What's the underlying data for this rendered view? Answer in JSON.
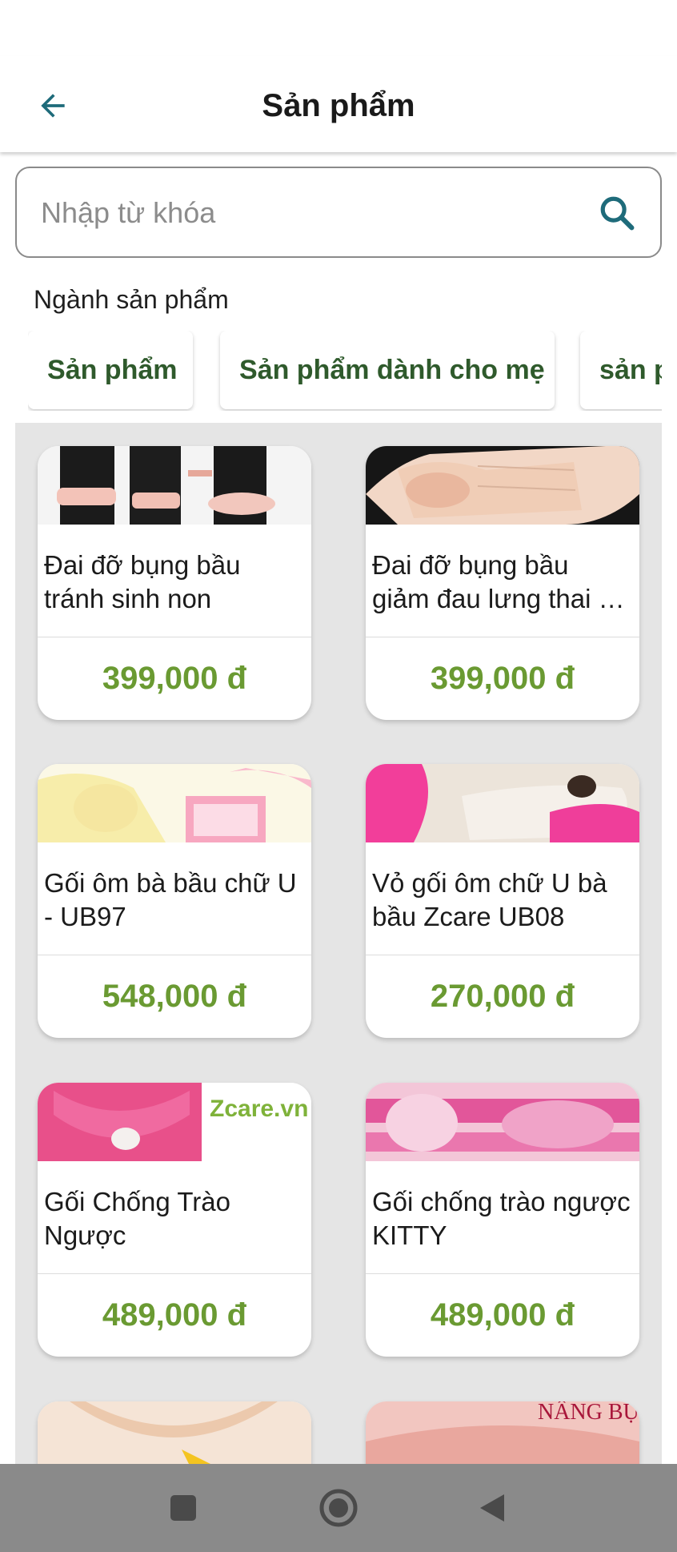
{
  "app_bar": {
    "title": "Sản phẩm",
    "back_icon": "arrow-left-icon"
  },
  "search": {
    "placeholder": "Nhập từ khóa",
    "icon": "search-icon"
  },
  "categories": {
    "label": "Ngành sản phẩm",
    "chips": [
      "Sản phẩm",
      "Sản phẩm dành cho mẹ",
      "sản p"
    ]
  },
  "products": [
    {
      "name": "Đai đỡ bụng bầu tránh sinh non",
      "price": "399,000 đ"
    },
    {
      "name": "Đai đỡ bụng bầu giảm đau lưng thai …",
      "price": "399,000 đ"
    },
    {
      "name": "Gối ôm bà bầu chữ U - UB97",
      "price": "548,000 đ"
    },
    {
      "name": "Vỏ gối ôm chữ U bà bầu Zcare UB08",
      "price": "270,000 đ"
    },
    {
      "name": "Gối Chống Trào Ngược",
      "price": "489,000 đ"
    },
    {
      "name": "Gối chống trào ngược KITTY",
      "price": "489,000 đ"
    }
  ],
  "image_text": {
    "zcare": "Zcare.vn",
    "nang_bung": "NÂNG BỤNG"
  },
  "colors": {
    "accent": "#1e6b7a",
    "price": "#6a9a32",
    "chip_text": "#2f5a2c",
    "grid_bg": "#e5e5e5",
    "nav_bar": "#8a8a8a"
  },
  "nav_bar": {
    "icons": [
      "square-icon",
      "circle-home-icon",
      "triangle-back-icon"
    ]
  }
}
